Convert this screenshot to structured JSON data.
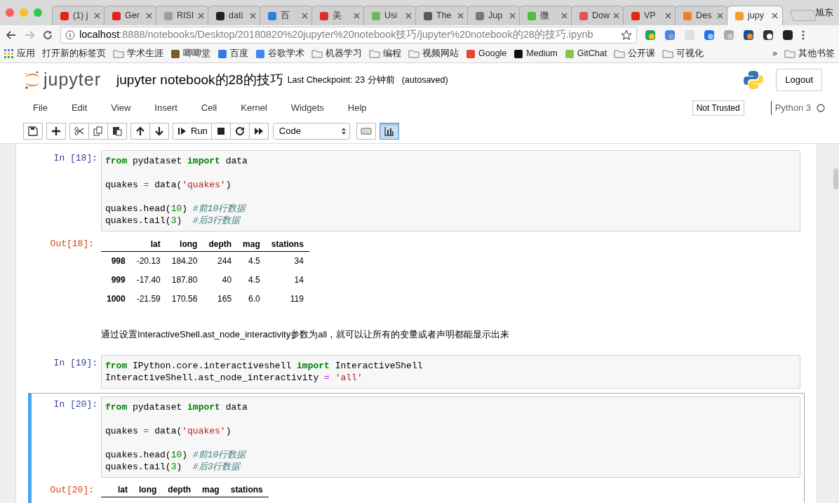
{
  "browser": {
    "tabs": [
      {
        "label": "(1) j",
        "color": "#e62117",
        "selected": false
      },
      {
        "label": "Ger",
        "color": "#e62117",
        "selected": false
      },
      {
        "label": "RISI",
        "color": "#9e9e9e",
        "selected": false
      },
      {
        "label": "dati",
        "color": "#222222",
        "selected": false
      },
      {
        "label": "百",
        "color": "#2f7de1",
        "selected": false
      },
      {
        "label": "美",
        "color": "#d9302c",
        "selected": false
      },
      {
        "label": "Usi",
        "color": "#6dbb55",
        "selected": false
      },
      {
        "label": "The",
        "color": "#555a66",
        "selected": false
      },
      {
        "label": "Jup",
        "color": "#777777",
        "selected": false
      },
      {
        "label": "微",
        "color": "#4cbf3a",
        "selected": false
      },
      {
        "label": "Dow",
        "color": "#e45256",
        "selected": false
      },
      {
        "label": "VP",
        "color": "#de2910",
        "selected": false
      },
      {
        "label": "Des",
        "color": "#f07c2a",
        "selected": false
      },
      {
        "label": "jupy",
        "color": "#f39a2c",
        "selected": true
      }
    ],
    "profile": "旭东",
    "url": {
      "host": "localhost",
      "path": ":8888/notebooks/Desktop/20180820%20jupyter%20notebook技巧/jupyter%20notebook的28的技巧.ipynb"
    },
    "bookmarks": [
      {
        "label": "应用",
        "kind": "apps"
      },
      {
        "label": "打开新的标签页",
        "kind": "plain"
      },
      {
        "label": "学术生涯",
        "kind": "folder"
      },
      {
        "label": "唧唧堂",
        "kind": "site",
        "color": "#7a5c2e"
      },
      {
        "label": "百度",
        "kind": "site",
        "color": "#2f7de1"
      },
      {
        "label": "谷歌学术",
        "kind": "site",
        "color": "#4285f4"
      },
      {
        "label": "机器学习",
        "kind": "folder"
      },
      {
        "label": "编程",
        "kind": "folder"
      },
      {
        "label": "视频网站",
        "kind": "folder"
      },
      {
        "label": "Google",
        "kind": "site",
        "color": "#ea4335"
      },
      {
        "label": "Medium",
        "kind": "site",
        "color": "#111111"
      },
      {
        "label": "GitChat",
        "kind": "site",
        "color": "#8bc34a"
      },
      {
        "label": "公开课",
        "kind": "folder"
      },
      {
        "label": "可视化",
        "kind": "folder"
      }
    ],
    "bookmarks_more": "»",
    "other_bookmarks": "其他书签"
  },
  "notebook": {
    "logo_text": "jupyter",
    "title": "jupyter notebook的28的技巧",
    "checkpoint": "Last Checkpoint: 23 分钟前",
    "autosave": "(autosaved)",
    "logout": "Logout",
    "menu": [
      "File",
      "Edit",
      "View",
      "Insert",
      "Cell",
      "Kernel",
      "Widgets",
      "Help"
    ],
    "trust": "Not Trusted",
    "kernel": "Python 3",
    "toolbar": [
      {
        "group": [
          {
            "kind": "save",
            "selected": false
          }
        ]
      },
      {
        "group": [
          {
            "kind": "add",
            "selected": false
          }
        ]
      },
      {
        "group": [
          {
            "kind": "cut",
            "selected": false
          },
          {
            "kind": "copy",
            "selected": false
          },
          {
            "kind": "paste",
            "selected": false
          }
        ]
      },
      {
        "group": [
          {
            "kind": "up",
            "selected": false
          },
          {
            "kind": "down",
            "selected": false
          }
        ]
      },
      {
        "group": [
          {
            "kind": "run",
            "label": "Run",
            "selected": false
          },
          {
            "kind": "stop",
            "selected": false
          },
          {
            "kind": "restart",
            "selected": false
          },
          {
            "kind": "fastforward",
            "selected": false
          }
        ]
      }
    ],
    "cell_type": "Code",
    "toolbar_extra": [
      {
        "kind": "keyboard",
        "selected": false
      },
      {
        "kind": "chart",
        "selected": true
      }
    ],
    "cells": [
      {
        "kind": "code",
        "prompt": "In [18]:",
        "selected": false,
        "lines": [
          {
            "kind": "code",
            "tokens": [
              {
                "kind": "keyword",
                "text": "from"
              },
              {
                "kind": "plain",
                "text": " pydataset "
              },
              {
                "kind": "keyword",
                "text": "import"
              },
              {
                "kind": "plain",
                "text": " data"
              }
            ]
          },
          {
            "kind": "blank"
          },
          {
            "kind": "code",
            "tokens": [
              {
                "kind": "plain",
                "text": "quakes "
              },
              {
                "kind": "operator",
                "text": "="
              },
              {
                "kind": "plain",
                "text": " data("
              },
              {
                "kind": "string",
                "text": "'quakes'"
              },
              {
                "kind": "plain",
                "text": ")"
              }
            ]
          },
          {
            "kind": "blank"
          },
          {
            "kind": "code",
            "tokens": [
              {
                "kind": "plain",
                "text": "quakes.head("
              },
              {
                "kind": "number",
                "text": "10"
              },
              {
                "kind": "plain",
                "text": ") "
              },
              {
                "kind": "comment",
                "text": "#前10行数据"
              }
            ]
          },
          {
            "kind": "code",
            "tokens": [
              {
                "kind": "plain",
                "text": "quakes.tail("
              },
              {
                "kind": "number",
                "text": "3"
              },
              {
                "kind": "plain",
                "text": ")  "
              },
              {
                "kind": "comment",
                "text": "#后3行数据"
              }
            ]
          }
        ],
        "output": {
          "prompt": "Out[18]:",
          "columns": [
            "lat",
            "long",
            "depth",
            "mag",
            "stations"
          ],
          "rows": [
            {
              "index": "998",
              "cells": [
                "-20.13",
                "184.20",
                "244",
                "4.5",
                "34"
              ]
            },
            {
              "index": "999",
              "cells": [
                "-17.40",
                "187.80",
                "40",
                "4.5",
                "14"
              ]
            },
            {
              "index": "1000",
              "cells": [
                "-21.59",
                "170.56",
                "165",
                "6.0",
                "119"
              ]
            }
          ]
        }
      },
      {
        "kind": "markdown",
        "text": "通过设置InteractiveShell.ast_node_interactivity参数为all，就可以让所有的变量或者声明都能显示出来"
      },
      {
        "kind": "code",
        "prompt": "In [19]:",
        "selected": false,
        "lines": [
          {
            "kind": "code",
            "tokens": [
              {
                "kind": "keyword",
                "text": "from"
              },
              {
                "kind": "plain",
                "text": " IPython.core.interactiveshell "
              },
              {
                "kind": "keyword",
                "text": "import"
              },
              {
                "kind": "plain",
                "text": " InteractiveShell"
              }
            ]
          },
          {
            "kind": "code",
            "tokens": [
              {
                "kind": "plain",
                "text": "InteractiveShell.ast_node_interactivity "
              },
              {
                "kind": "operator",
                "text": "= "
              },
              {
                "kind": "string",
                "text": "'all'"
              }
            ]
          }
        ]
      },
      {
        "kind": "code",
        "prompt": "In [20]:",
        "selected": true,
        "lines": [
          {
            "kind": "code",
            "tokens": [
              {
                "kind": "keyword",
                "text": "from"
              },
              {
                "kind": "plain",
                "text": " pydataset "
              },
              {
                "kind": "keyword",
                "text": "import"
              },
              {
                "kind": "plain",
                "text": " data"
              }
            ]
          },
          {
            "kind": "blank"
          },
          {
            "kind": "code",
            "tokens": [
              {
                "kind": "plain",
                "text": "quakes "
              },
              {
                "kind": "operator",
                "text": "="
              },
              {
                "kind": "plain",
                "text": " data("
              },
              {
                "kind": "string",
                "text": "'quakes'"
              },
              {
                "kind": "plain",
                "text": ")"
              }
            ]
          },
          {
            "kind": "blank"
          },
          {
            "kind": "code",
            "tokens": [
              {
                "kind": "plain",
                "text": "quakes.head("
              },
              {
                "kind": "number",
                "text": "10"
              },
              {
                "kind": "plain",
                "text": ") "
              },
              {
                "kind": "comment",
                "text": "#前10行数据"
              }
            ]
          },
          {
            "kind": "code",
            "tokens": [
              {
                "kind": "plain",
                "text": "quakes.tail("
              },
              {
                "kind": "number",
                "text": "3"
              },
              {
                "kind": "plain",
                "text": ")  "
              },
              {
                "kind": "comment",
                "text": "#后3行数据"
              }
            ]
          }
        ],
        "output": {
          "prompt": "Out[20]:",
          "columns": [
            "lat",
            "long",
            "depth",
            "mag",
            "stations"
          ]
        }
      }
    ]
  }
}
